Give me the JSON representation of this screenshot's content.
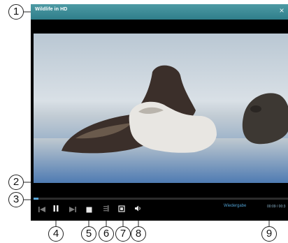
{
  "window": {
    "title": "Wildlife in HD",
    "close_glyph": "×"
  },
  "video": {
    "subject": "sea lions resting on a sandy beach"
  },
  "playback": {
    "progress_fraction": 0.02,
    "status_text": "Wiedergabe",
    "time_text": "00:09 / 00:3"
  },
  "controls": {
    "previous_icon": "skip-previous-icon",
    "pause_icon": "pause-icon",
    "next_icon": "skip-next-icon",
    "stop_icon": "stop-icon",
    "playlist_icon": "playlist-icon",
    "fullscreen_icon": "fullscreen-icon",
    "volume_icon": "volume-icon"
  },
  "callouts": [
    "1",
    "2",
    "3",
    "4",
    "5",
    "6",
    "7",
    "8",
    "9"
  ]
}
